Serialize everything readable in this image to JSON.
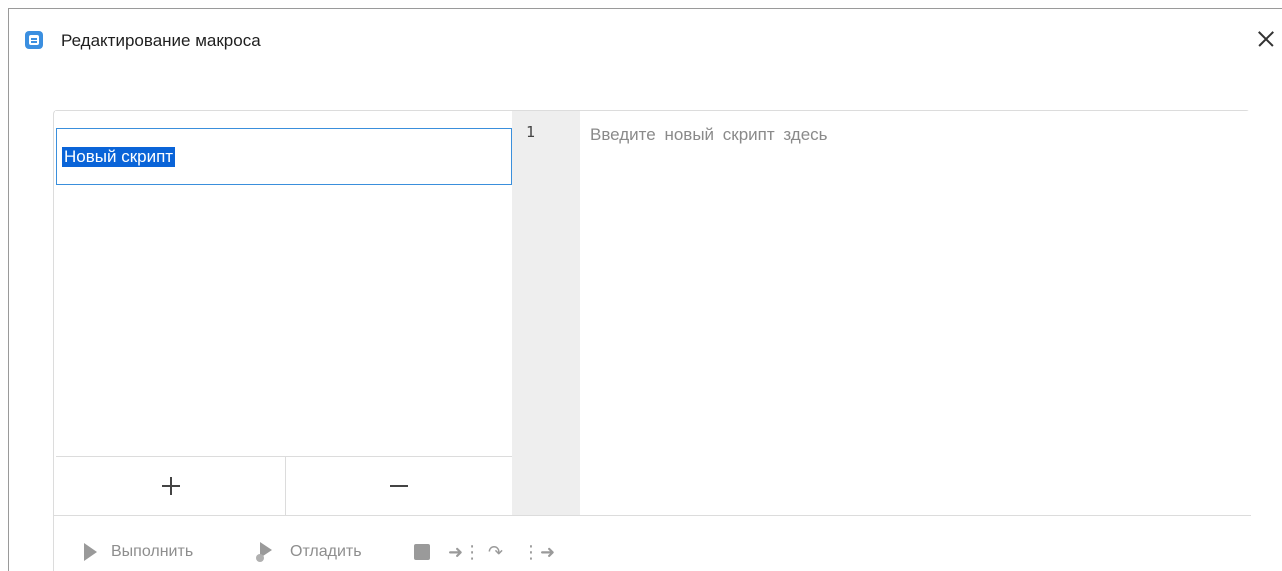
{
  "window": {
    "title": "Редактирование макроса",
    "icons": {
      "app": "app-logo-icon",
      "close": "close-icon"
    }
  },
  "scripts": {
    "items": [
      {
        "name": "Новый скрипт",
        "selected": true
      }
    ],
    "add_label": "+",
    "remove_label": "−"
  },
  "editor": {
    "line_numbers": [
      "1"
    ],
    "placeholder": "Введите новый скрипт здесь"
  },
  "toolbar": {
    "run_label": "Выполнить",
    "debug_label": "Отладить",
    "icons": {
      "run": "play-icon",
      "debug": "debug-icon",
      "stop": "stop-icon",
      "step_into": "step-into-icon",
      "step_over": "step-over-icon",
      "step_out": "step-out-icon"
    }
  },
  "colors": {
    "accent": "#3b8fe0",
    "selection": "#0a64d8",
    "gutter": "#eeeeee",
    "disabled_text": "#8e8e8e"
  }
}
